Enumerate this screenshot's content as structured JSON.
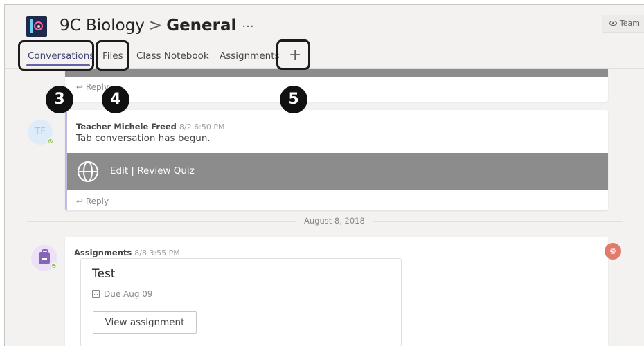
{
  "header": {
    "team_name": "9C Biology",
    "separator": ">",
    "channel_name": "General",
    "more": "···",
    "team_button": "Team"
  },
  "tabs": [
    {
      "label": "Conversations",
      "active": true
    },
    {
      "label": "Files",
      "active": false
    },
    {
      "label": "Class Notebook",
      "active": false
    },
    {
      "label": "Assignments",
      "active": false
    }
  ],
  "add_tab": "+",
  "callouts": [
    "3",
    "4",
    "5"
  ],
  "thread_top": {
    "reply": "Reply"
  },
  "post": {
    "avatar_initials": "TF",
    "author": "Teacher Michele Freed",
    "time": "8/2 6:50 PM",
    "text": "Tab conversation has begun.",
    "tab_link": "Edit | Review Quiz",
    "reply": "Reply"
  },
  "date_divider": "August 8, 2018",
  "assignment_post": {
    "author": "Assignments",
    "time": "8/8 3:55 PM",
    "card_title": "Test",
    "due": "Due Aug 09",
    "button": "View assignment"
  },
  "colors": {
    "accent": "#6264a7",
    "background": "#f3f2f1",
    "band": "#8c8c8c",
    "presence": "#92c353"
  }
}
